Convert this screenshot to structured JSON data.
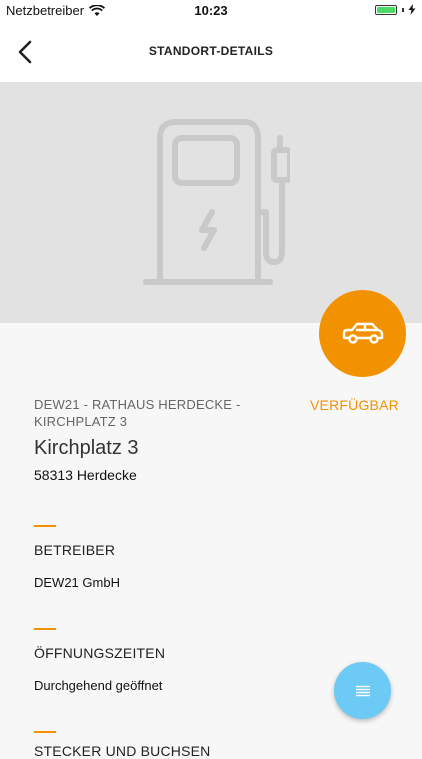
{
  "status_bar": {
    "carrier": "Netzbetreiber",
    "time": "10:23"
  },
  "nav": {
    "title": "STANDORT-DETAILS"
  },
  "station": {
    "name": "DEW21 - RATHAUS HERDECKE - KIRCHPLATZ 3",
    "availability": "VERFÜGBAR",
    "street": "Kirchplatz 3",
    "city": "58313 Herdecke"
  },
  "sections": [
    {
      "label": "BETREIBER",
      "value": "DEW21 GmbH"
    },
    {
      "label": "ÖFFNUNGSZEITEN",
      "value": "Durchgehend geöffnet"
    },
    {
      "label": "STECKER UND BUCHSEN"
    }
  ],
  "colors": {
    "accent": "#f39200",
    "fab_menu": "#6ccaf5",
    "hero_bg": "#e2e2e2"
  },
  "icons": {
    "hero": "charging-station-icon",
    "fab_car": "car-icon",
    "fab_menu": "list-icon"
  }
}
